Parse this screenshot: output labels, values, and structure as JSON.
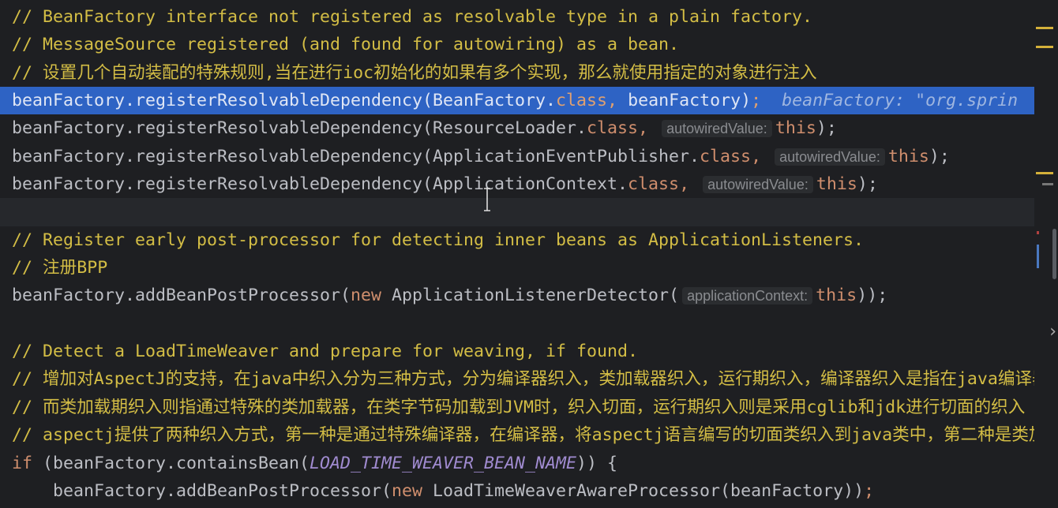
{
  "editor": {
    "lines": [
      {
        "state": "",
        "tokens": [
          {
            "c": "comment",
            "t": "// BeanFactory interface not registered as resolvable type in a plain factory."
          }
        ]
      },
      {
        "state": "",
        "tokens": [
          {
            "c": "comment",
            "t": "// MessageSource registered (and found for autowiring) as a bean."
          }
        ]
      },
      {
        "state": "",
        "tokens": [
          {
            "c": "comment",
            "t": "// 设置几个自动装配的特殊规则,当在进行ioc初始化的如果有多个实现，那么就使用指定的对象进行注入"
          }
        ]
      },
      {
        "state": "sel",
        "tokens": [
          {
            "c": "plain",
            "t": "beanFactory.registerResolvableDependency(BeanFactory."
          },
          {
            "c": "kw",
            "t": "class"
          },
          {
            "c": "kw",
            "t": ", "
          },
          {
            "c": "plain",
            "t": "beanFactory)"
          },
          {
            "c": "kw",
            "t": ";"
          },
          {
            "c": "debug",
            "t": "  beanFactory: \"org.sprin"
          }
        ]
      },
      {
        "state": "",
        "tokens": [
          {
            "c": "plain",
            "t": "beanFactory.registerResolvableDependency(ResourceLoader."
          },
          {
            "c": "kw",
            "t": "class"
          },
          {
            "c": "kw",
            "t": ", "
          },
          {
            "c": "inlay",
            "t": "autowiredValue:"
          },
          {
            "c": "kw",
            "t": "this"
          },
          {
            "c": "plain",
            "t": ");"
          }
        ]
      },
      {
        "state": "",
        "tokens": [
          {
            "c": "plain",
            "t": "beanFactory.registerResolvableDependency(ApplicationEventPublisher."
          },
          {
            "c": "kw",
            "t": "class"
          },
          {
            "c": "kw",
            "t": ", "
          },
          {
            "c": "inlay",
            "t": "autowiredValue:"
          },
          {
            "c": "kw",
            "t": "this"
          },
          {
            "c": "plain",
            "t": ");"
          }
        ]
      },
      {
        "state": "",
        "tokens": [
          {
            "c": "plain",
            "t": "beanFactory.registerResolvableDependency(ApplicationContext."
          },
          {
            "c": "kw",
            "t": "class"
          },
          {
            "c": "kw",
            "t": ", "
          },
          {
            "c": "inlay",
            "t": "autowiredValue:"
          },
          {
            "c": "kw",
            "t": "this"
          },
          {
            "c": "plain",
            "t": ");"
          }
        ]
      },
      {
        "state": "caret",
        "tokens": []
      },
      {
        "state": "",
        "tokens": [
          {
            "c": "comment",
            "t": "// Register early post-processor for detecting inner beans as ApplicationListeners."
          }
        ]
      },
      {
        "state": "",
        "tokens": [
          {
            "c": "comment",
            "t": "// 注册BPP"
          }
        ]
      },
      {
        "state": "",
        "tokens": [
          {
            "c": "plain",
            "t": "beanFactory.addBeanPostProcessor("
          },
          {
            "c": "kw",
            "t": "new "
          },
          {
            "c": "plain",
            "t": "ApplicationListenerDetector("
          },
          {
            "c": "inlay",
            "t": "applicationContext:"
          },
          {
            "c": "kw",
            "t": "this"
          },
          {
            "c": "plain",
            "t": "));"
          }
        ]
      },
      {
        "state": "",
        "tokens": []
      },
      {
        "state": "",
        "tokens": [
          {
            "c": "comment",
            "t": "// Detect a LoadTimeWeaver and prepare for weaving, if found."
          }
        ]
      },
      {
        "state": "",
        "tokens": [
          {
            "c": "comment",
            "t": "// 增加对AspectJ的支持，在java中织入分为三种方式，分为编译器织入，类加载器织入，运行期织入，编译器织入是指在java编译器，"
          }
        ]
      },
      {
        "state": "",
        "tokens": [
          {
            "c": "comment",
            "t": "// 而类加载期织入则指通过特殊的类加载器，在类字节码加载到JVM时，织入切面，运行期织入则是采用cglib和jdk进行切面的织入"
          }
        ]
      },
      {
        "state": "",
        "tokens": [
          {
            "c": "comment",
            "t": "// aspectj提供了两种织入方式，第一种是通过特殊编译器，在编译器，将aspectj语言编写的切面类织入到java类中，第二种是类加载"
          }
        ]
      },
      {
        "state": "",
        "tokens": [
          {
            "c": "kw",
            "t": "if "
          },
          {
            "c": "plain",
            "t": "(beanFactory.containsBean("
          },
          {
            "c": "const",
            "t": "LOAD_TIME_WEAVER_BEAN_NAME"
          },
          {
            "c": "plain",
            "t": ")) {"
          }
        ]
      },
      {
        "state": "",
        "tokens": [
          {
            "c": "plain",
            "t": "    beanFactory.addBeanPostProcessor("
          },
          {
            "c": "kw",
            "t": "new "
          },
          {
            "c": "plain",
            "t": "LoadTimeWeaverAwareProcessor(beanFactory))"
          },
          {
            "c": "kw",
            "t": ";"
          }
        ]
      }
    ]
  },
  "colors": {
    "background": "#1e1f22",
    "selection": "#2e63c4",
    "comment": "#d3bd45",
    "keyword": "#cf8e6d",
    "constant": "#a08bd0"
  },
  "icons": {
    "cursor": "text-ibeam-icon",
    "chevron": "chevron-right-icon"
  }
}
